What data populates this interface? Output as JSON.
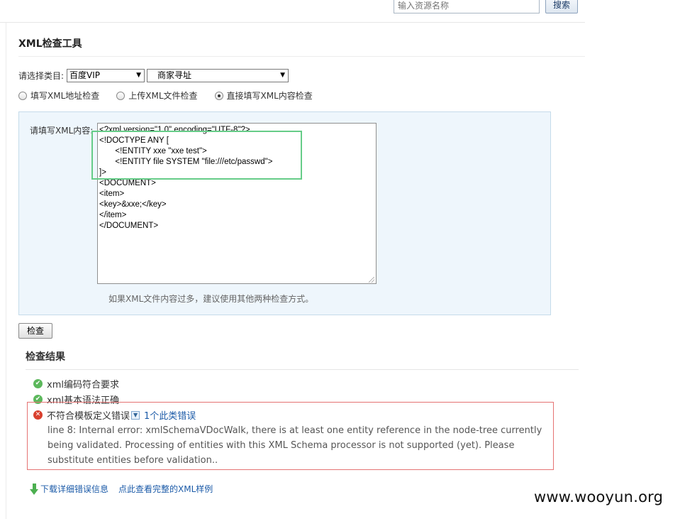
{
  "header": {
    "search_placeholder": "输入资源名称",
    "search_button": "搜索"
  },
  "tool": {
    "title": "XML检查工具",
    "category_label": "请选择类目:",
    "category_selected": "百度VIP",
    "subcategory_selected": "商家寻址",
    "radios": [
      {
        "label": "填写XML地址检查",
        "checked": false
      },
      {
        "label": "上传XML文件检查",
        "checked": false
      },
      {
        "label": "直接填写XML内容检查",
        "checked": true
      }
    ],
    "content_label": "请填写XML内容:",
    "xml_content": "<?xml version=\"1.0\" encoding=\"UTF-8\"?>\n<!DOCTYPE ANY [\n       <!ENTITY xxe \"xxe test\">\n       <!ENTITY file SYSTEM \"file:///etc/passwd\">\n]>\n<DOCUMENT>\n<item>\n<key>&xxe;</key>\n</item>\n</DOCUMENT>",
    "hint": "如果XML文件内容过多，建议使用其他两种检查方式。",
    "check_button": "检查"
  },
  "results": {
    "title": "检查结果",
    "items": [
      {
        "status": "ok",
        "text": "xml编码符合要求"
      },
      {
        "status": "ok",
        "text": "xml基本语法正确"
      }
    ],
    "error": {
      "text": "不符合模板定义错误",
      "count_link": "1个此类错误",
      "detail": "line 8: Internal error: xmlSchemaVDocWalk, there is at least one entity reference in the node-tree currently being validated. Processing of entities with this XML Schema processor is not supported (yet). Please substitute entities before validation.."
    },
    "download_link": "下载详细错误信息",
    "sample_link": "点此查看完整的XML样例"
  },
  "watermark": "www.wooyun.org",
  "colors": {
    "ok": "#5cb85c",
    "error": "#d9402e",
    "link": "#1c5ba8",
    "panel_bg": "#eef6fc"
  }
}
